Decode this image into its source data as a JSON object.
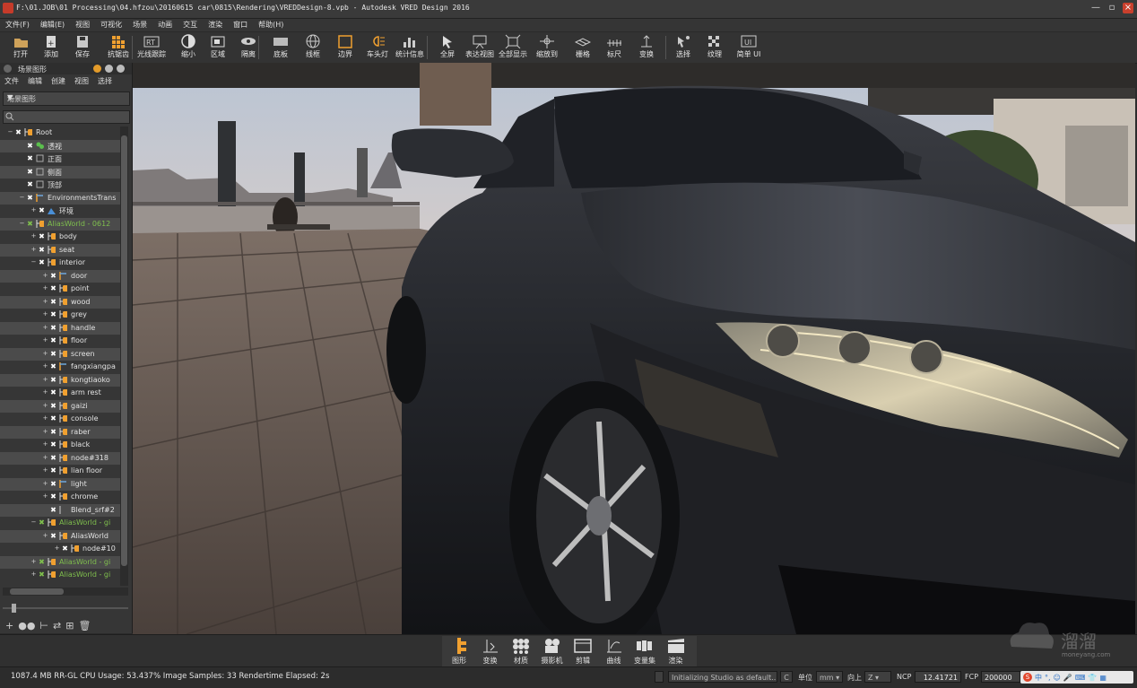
{
  "window": {
    "title": "F:\\01.JOB\\01 Processing\\04.hfzou\\20160615 car\\0815\\Rendering\\VREDDesign-8.vpb - Autodesk VRED Design 2016",
    "controls": [
      "—",
      "▫",
      "×"
    ]
  },
  "menu": [
    "文件(F)",
    "编辑(E)",
    "视图",
    "可视化",
    "场景",
    "动画",
    "交互",
    "渲染",
    "窗口",
    "帮助(H)"
  ],
  "toolbar": [
    {
      "label": "打开",
      "icon": "folder-open-icon"
    },
    {
      "label": "添加",
      "icon": "add-file-icon"
    },
    {
      "label": "保存",
      "icon": "save-icon"
    },
    {
      "label": "抗锯齿",
      "icon": "antialias-grid-icon"
    },
    {
      "label": "光线跟踪",
      "icon": "raytrace-rt-icon"
    },
    {
      "label": "缩小",
      "icon": "half-circle-icon"
    },
    {
      "label": "区域",
      "icon": "region-icon"
    },
    {
      "label": "隔离",
      "icon": "isolate-eye-icon"
    },
    {
      "label": "底板",
      "icon": "backplate-icon"
    },
    {
      "label": "线框",
      "icon": "wireframe-globe-icon"
    },
    {
      "label": "边界",
      "icon": "bounding-box-icon"
    },
    {
      "label": "车头灯",
      "icon": "headlight-icon"
    },
    {
      "label": "统计信息",
      "icon": "statistics-bar-icon"
    },
    {
      "label": "全屏",
      "icon": "fullscreen-cursor-icon"
    },
    {
      "label": "表达视图",
      "icon": "presentation-icon"
    },
    {
      "label": "全部显示",
      "icon": "show-all-icon"
    },
    {
      "label": "缩放到",
      "icon": "zoom-to-icon"
    },
    {
      "label": "栅格",
      "icon": "grid-icon"
    },
    {
      "label": "标尺",
      "icon": "ruler-icon"
    },
    {
      "label": "变换",
      "icon": "transform-icon"
    },
    {
      "label": "选择",
      "icon": "select-wand-icon"
    },
    {
      "label": "纹理",
      "icon": "texture-icon"
    },
    {
      "label": "简单 UI",
      "icon": "simple-ui-icon"
    }
  ],
  "panel": {
    "title": "场景图形",
    "menu": [
      "文件",
      "编辑",
      "创建",
      "视图",
      "选择"
    ],
    "dropdown_value": "场景图形",
    "tree": [
      {
        "label": "Root",
        "depth": 0,
        "type": "group",
        "green": false
      },
      {
        "label": "透视",
        "depth": 1,
        "type": "camera",
        "green": false
      },
      {
        "label": "正面",
        "depth": 1,
        "type": "camera-off",
        "green": false
      },
      {
        "label": "侧面",
        "depth": 1,
        "type": "camera-off",
        "green": false
      },
      {
        "label": "顶部",
        "depth": 1,
        "type": "camera-off",
        "green": false
      },
      {
        "label": "EnvironmentsTrans",
        "depth": 1,
        "type": "transform",
        "green": false
      },
      {
        "label": "环境",
        "depth": 2,
        "type": "environment",
        "green": false
      },
      {
        "label": "AliasWorld - 0612",
        "depth": 1,
        "type": "group",
        "green": true
      },
      {
        "label": "body",
        "depth": 2,
        "type": "group",
        "green": false
      },
      {
        "label": "seat",
        "depth": 2,
        "type": "group",
        "green": false
      },
      {
        "label": "interior",
        "depth": 2,
        "type": "group",
        "green": false
      },
      {
        "label": "door",
        "depth": 3,
        "type": "transform",
        "green": false
      },
      {
        "label": "point",
        "depth": 3,
        "type": "group",
        "green": false
      },
      {
        "label": "wood",
        "depth": 3,
        "type": "group",
        "green": false
      },
      {
        "label": "grey",
        "depth": 3,
        "type": "group",
        "green": false
      },
      {
        "label": "handle",
        "depth": 3,
        "type": "group",
        "green": false
      },
      {
        "label": "floor",
        "depth": 3,
        "type": "group",
        "green": false
      },
      {
        "label": "screen",
        "depth": 3,
        "type": "group",
        "green": false
      },
      {
        "label": "fangxiangpa",
        "depth": 3,
        "type": "transform",
        "green": false
      },
      {
        "label": "kongtiaoko",
        "depth": 3,
        "type": "group",
        "green": false
      },
      {
        "label": "arm rest",
        "depth": 3,
        "type": "group",
        "green": false
      },
      {
        "label": "gaizi",
        "depth": 3,
        "type": "group",
        "green": false
      },
      {
        "label": "console",
        "depth": 3,
        "type": "group",
        "green": false
      },
      {
        "label": "raber",
        "depth": 3,
        "type": "group",
        "green": false
      },
      {
        "label": "black",
        "depth": 3,
        "type": "group",
        "green": false
      },
      {
        "label": "node#318",
        "depth": 3,
        "type": "group",
        "green": false
      },
      {
        "label": "lian floor",
        "depth": 3,
        "type": "group",
        "green": false
      },
      {
        "label": "light",
        "depth": 3,
        "type": "transform",
        "green": false
      },
      {
        "label": "chrome",
        "depth": 3,
        "type": "group",
        "green": false
      },
      {
        "label": "Blend_srf#2",
        "depth": 3,
        "type": "leaf",
        "green": false
      },
      {
        "label": "AliasWorld - gi",
        "depth": 2,
        "type": "group",
        "green": true
      },
      {
        "label": "AliasWorld",
        "depth": 3,
        "type": "group",
        "green": false
      },
      {
        "label": "node#10",
        "depth": 4,
        "type": "group",
        "green": false
      },
      {
        "label": "AliasWorld - gi",
        "depth": 2,
        "type": "group",
        "green": true
      },
      {
        "label": "AliasWorld - gi",
        "depth": 2,
        "type": "group",
        "green": true
      }
    ],
    "bottom_tools": [
      "+",
      "●●",
      "⊢",
      "⇄",
      "⊞",
      "🗑"
    ]
  },
  "dock": [
    {
      "label": "图形",
      "icon": "scenegraph-icon",
      "active": true
    },
    {
      "label": "变换",
      "icon": "transform-icon",
      "active": false
    },
    {
      "label": "材质",
      "icon": "materials-icon",
      "active": false
    },
    {
      "label": "摄影机",
      "icon": "camera-icon",
      "active": false
    },
    {
      "label": "剪辑",
      "icon": "clip-icon",
      "active": false
    },
    {
      "label": "曲线",
      "icon": "curve-icon",
      "active": false
    },
    {
      "label": "变量集",
      "icon": "variant-sets-icon",
      "active": false
    },
    {
      "label": "渲染",
      "icon": "render-clapper-icon",
      "active": false
    }
  ],
  "status": {
    "message": "1087.4 MB  RR-GL CPU Usage: 53.437% Image Samples: 33 Rendertime Elapsed: 2s",
    "info_field": "Initializing Studio as default...",
    "c_label": "C",
    "unit_label": "单位",
    "unit_value": "mm",
    "up_label": "向上",
    "up_value": "Z",
    "ncp_label": "NCP",
    "ncp_value": "12.41721",
    "fcp_label": "FCP",
    "fcp_value": "200000"
  },
  "tray": [
    "S",
    "中",
    "°,",
    "☺",
    "🎤",
    "⌨",
    "👕",
    "▦"
  ],
  "watermark": {
    "text": "溜溜",
    "url": "moneyang.com"
  },
  "colors": {
    "accent": "#f0a030",
    "green_node": "#7fbf4d",
    "close": "#c9402d"
  }
}
